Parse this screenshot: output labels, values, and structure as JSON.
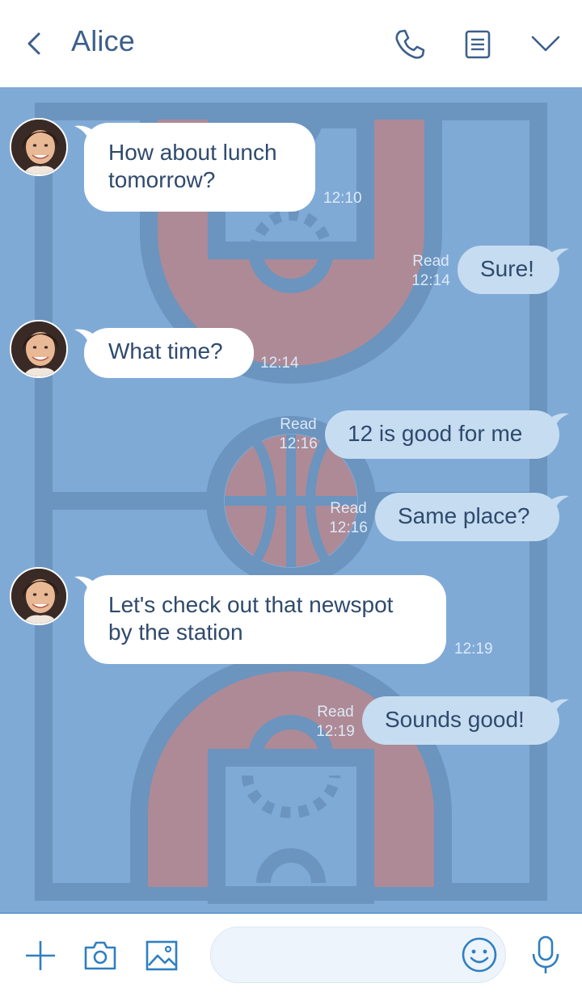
{
  "header": {
    "title": "Alice",
    "icons": [
      "back-icon",
      "phone-icon",
      "notes-icon",
      "chevron-down-icon"
    ]
  },
  "messages": [
    {
      "side": "in",
      "text_lines": [
        "How about lunch",
        "tomorrow?"
      ],
      "time": "12:10"
    },
    {
      "side": "out",
      "text": "Sure!",
      "read": "Read",
      "time": "12:14"
    },
    {
      "side": "in",
      "text": "What time?",
      "time": "12:14"
    },
    {
      "side": "out",
      "text": "12 is good for me",
      "read": "Read",
      "time": "12:16"
    },
    {
      "side": "out",
      "text": "Same place?",
      "read": "Read",
      "time": "12:16"
    },
    {
      "side": "in",
      "text_lines": [
        "Let's check out that newspot",
        "by the station"
      ],
      "time": "12:19"
    },
    {
      "side": "out",
      "text": "Sounds good!",
      "read": "Read",
      "time": "12:19"
    }
  ],
  "footer": {
    "input_value": "",
    "input_placeholder": "",
    "icons": [
      "plus-icon",
      "camera-icon",
      "image-icon",
      "smiley-icon",
      "microphone-icon"
    ]
  },
  "colors": {
    "chat_background": "#80aad6",
    "court_lines": "#6b94bf",
    "court_paint": "#ad8a96",
    "incoming_bubble": "#ffffff",
    "outgoing_bubble": "#c6dcf0",
    "accent": "#2f7fc0"
  }
}
